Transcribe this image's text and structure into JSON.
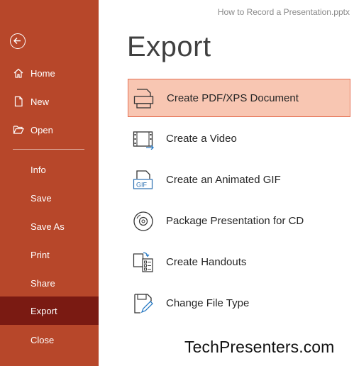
{
  "document": {
    "title": "How to Record a Presentation.pptx"
  },
  "sidebar": {
    "background": "#b7472a",
    "active_background": "#7a1a12",
    "back_icon": "back-arrow-icon",
    "items": [
      {
        "label": "Home",
        "icon": "home-icon"
      },
      {
        "label": "New",
        "icon": "new-document-icon"
      },
      {
        "label": "Open",
        "icon": "open-folder-icon"
      },
      {
        "label": "Info"
      },
      {
        "label": "Save"
      },
      {
        "label": "Save As"
      },
      {
        "label": "Print"
      },
      {
        "label": "Share"
      },
      {
        "label": "Export",
        "active": true
      },
      {
        "label": "Close"
      }
    ]
  },
  "main": {
    "title": "Export",
    "options": [
      {
        "label": "Create PDF/XPS Document",
        "icon": "pdf-document-icon",
        "selected": true
      },
      {
        "label": "Create a Video",
        "icon": "video-icon"
      },
      {
        "label": "Create an Animated GIF",
        "icon": "gif-icon"
      },
      {
        "label": "Package Presentation for CD",
        "icon": "cd-icon"
      },
      {
        "label": "Create Handouts",
        "icon": "handouts-icon"
      },
      {
        "label": "Change File Type",
        "icon": "change-file-type-icon"
      }
    ]
  },
  "watermark": {
    "text": "TechPresenters.com"
  }
}
